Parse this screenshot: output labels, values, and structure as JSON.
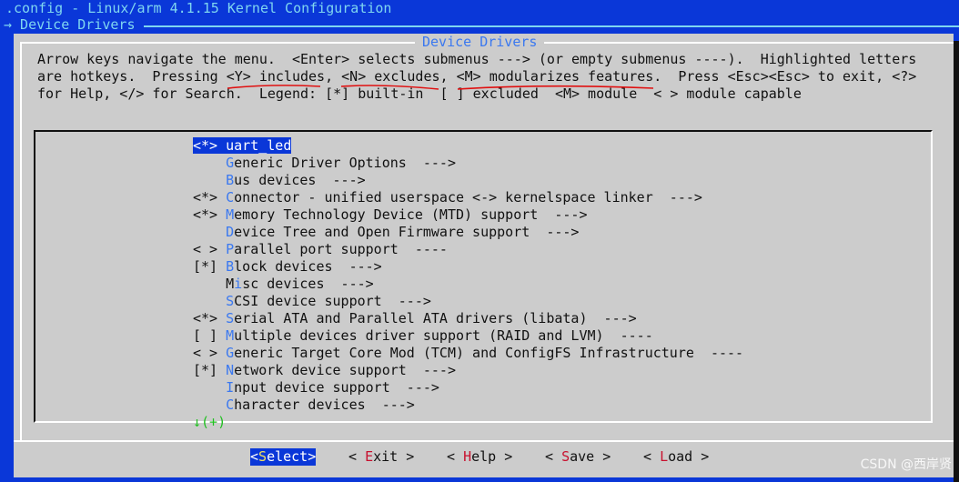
{
  "window": {
    "title": ".config - Linux/arm 4.1.15 Kernel Configuration",
    "breadcrumb": "→ Device Drivers"
  },
  "dialog": {
    "title": "Device Drivers",
    "help": [
      "Arrow keys navigate the menu.  <Enter> selects submenus ---> (or empty submenus ----).  Highlighted letters",
      "are hotkeys.  Pressing <Y> includes, <N> excludes, <M> modularizes features.  Press <Esc><Esc> to exit, <?>",
      "for Help, </> for Search.  Legend: [*] built-in  [ ] excluded  <M> module  < > module capable"
    ]
  },
  "menu": {
    "items": [
      {
        "prefix": "<*> ",
        "hotkey": "u",
        "rest": "art_led",
        "selected": true
      },
      {
        "prefix": "    ",
        "hotkey": "G",
        "rest": "eneric Driver Options  --->"
      },
      {
        "prefix": "    ",
        "hotkey": "B",
        "rest": "us devices  --->"
      },
      {
        "prefix": "<*> ",
        "hotkey": "C",
        "rest": "onnector - unified userspace <-> kernelspace linker  --->"
      },
      {
        "prefix": "<*> ",
        "hotkey": "M",
        "rest": "emory Technology Device (MTD) support  --->"
      },
      {
        "prefix": "    ",
        "hotkey": "D",
        "rest": "evice Tree and Open Firmware support  --->"
      },
      {
        "prefix": "< > ",
        "hotkey": "P",
        "rest": "arallel port support  ----"
      },
      {
        "prefix": "[*] ",
        "hotkey": "B",
        "rest": "lock devices  --->"
      },
      {
        "prefix": "    M",
        "hotkey": "i",
        "rest": "sc devices  --->"
      },
      {
        "prefix": "    ",
        "hotkey": "S",
        "rest": "CSI device support  --->"
      },
      {
        "prefix": "<*> ",
        "hotkey": "S",
        "rest": "erial ATA and Parallel ATA drivers (libata)  --->"
      },
      {
        "prefix": "[ ] ",
        "hotkey": "M",
        "rest": "ultiple devices driver support (RAID and LVM)  ----"
      },
      {
        "prefix": "< > ",
        "hotkey": "G",
        "rest": "eneric Target Core Mod (TCM) and ConfigFS Infrastructure  ----"
      },
      {
        "prefix": "[*] ",
        "hotkey": "N",
        "rest": "etwork device support  --->"
      },
      {
        "prefix": "    ",
        "hotkey": "I",
        "rest": "nput device support  --->"
      },
      {
        "prefix": "    ",
        "hotkey": "C",
        "rest": "haracter devices  --->"
      }
    ],
    "more": "↓(+)"
  },
  "buttons": [
    {
      "pre": "<",
      "hotkey": "S",
      "rest": "elect>",
      "active": true
    },
    {
      "pre": "< ",
      "hotkey": "E",
      "rest": "xit >"
    },
    {
      "pre": "< ",
      "hotkey": "H",
      "rest": "elp >"
    },
    {
      "pre": "< ",
      "hotkey": "S",
      "rest": "ave >"
    },
    {
      "pre": "< ",
      "hotkey": "L",
      "rest": "oad >"
    }
  ],
  "watermark": "CSDN @西岸贤",
  "colors": {
    "background": "#0a37d8",
    "dialog": "#cccccc",
    "hotkey": "#3a78f0",
    "button_hotkey": "#c8102e",
    "annotation": "#e01010"
  }
}
